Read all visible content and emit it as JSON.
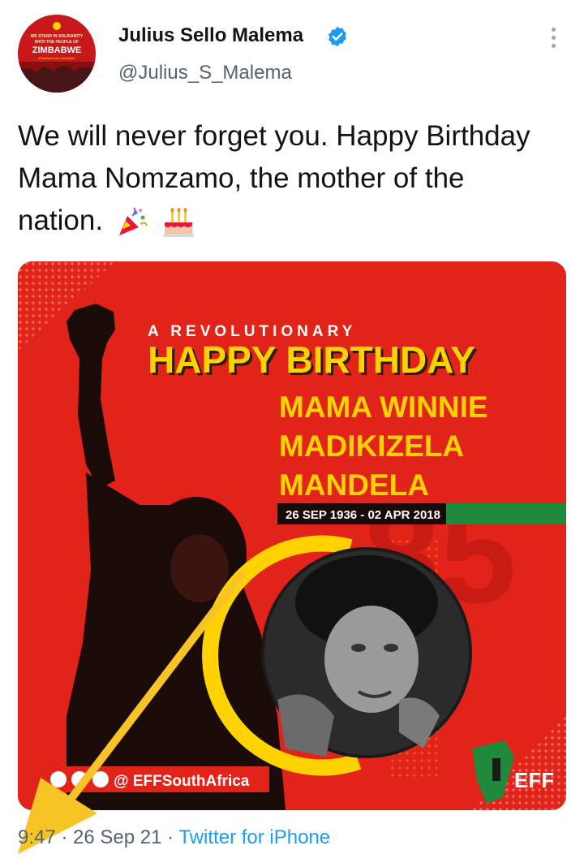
{
  "author": {
    "name": "Julius Sello Malema",
    "handle": "@Julius_S_Malema",
    "avatar_text": {
      "line1": "WE STAND IN SOLIDARITY",
      "line2": "WITH THE PEOPLE OF",
      "line3": "ZIMBABWE",
      "line4": "#ZimbabweanLivesMatter"
    }
  },
  "tweet": {
    "text": "We will never forget you. Happy Birthday Mama Nomzamo, the mother of the nation.",
    "emojis": [
      "party-popper",
      "birthday-cake"
    ]
  },
  "media": {
    "kicker": "A REVOLUTIONARY",
    "headline": "HAPPY BIRTHDAY",
    "name_line1": "MAMA WINNIE",
    "name_line2": "MADIKIZELA",
    "name_line3": "MANDELA",
    "dates": "26 SEP 1936 - 02 APR 2018",
    "social_handle": "@ EFFSouthAfrica",
    "logo_text": "EFF",
    "watermark": "85",
    "colors": {
      "background": "#e2231a",
      "accent": "#ffd200",
      "green": "#1f8a3b"
    }
  },
  "footer": {
    "time": "9:47",
    "date": "26 Sep 21",
    "source": "Twitter for iPhone",
    "sep": " · "
  },
  "annotation": {
    "arrow_color": "#f7c325"
  }
}
